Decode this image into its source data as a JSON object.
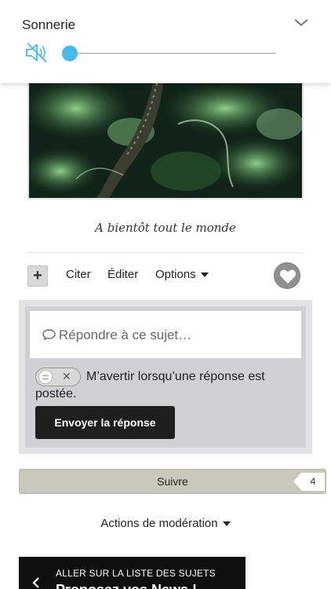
{
  "volume": {
    "title": "Sonnerie",
    "level_percent": 0
  },
  "post": {
    "signature": "A bientôt tout le monde"
  },
  "actions": {
    "plus_label": "+",
    "cite_label": "Citer",
    "edit_label": "Éditer",
    "options_label": "Options"
  },
  "reply": {
    "placeholder": "Répondre à ce sujet…",
    "notify_label": "M’avertir lorsqu’une réponse est postée.",
    "send_label": "Envoyer la réponse"
  },
  "follow": {
    "label": "Suivre",
    "count": "4"
  },
  "moderation": {
    "label": "Actions de modération"
  },
  "topic_nav": {
    "back_label": "ALLER SUR LA LISTE DES SUJETS",
    "next_title": "Proposez vos News !"
  },
  "colors": {
    "slider_accent": "#49b8e9",
    "send_button": "#1f1f1f",
    "follow_bar": "#c9c7bb"
  }
}
